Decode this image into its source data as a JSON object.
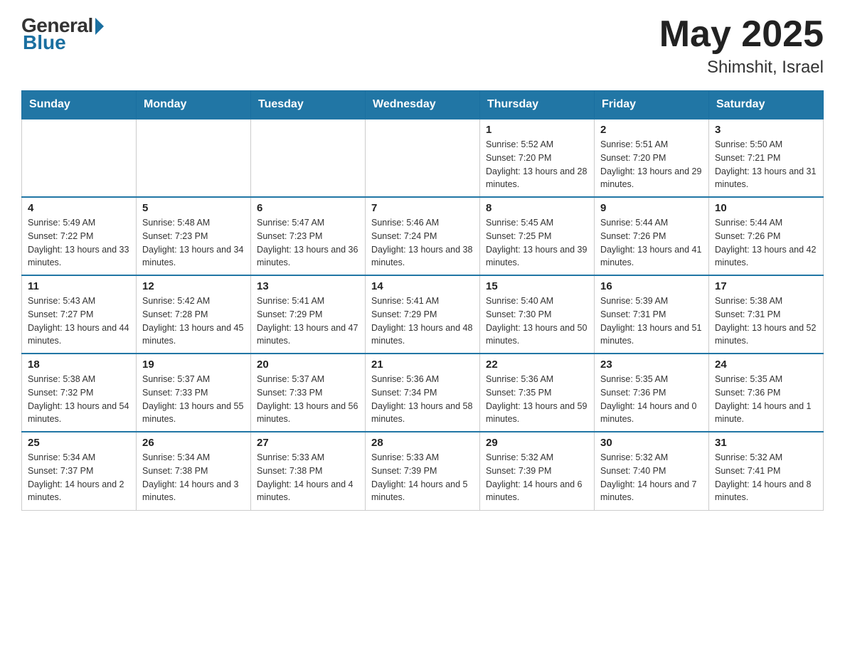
{
  "header": {
    "logo_general": "General",
    "logo_blue": "Blue",
    "month_year": "May 2025",
    "location": "Shimshit, Israel"
  },
  "days_of_week": [
    "Sunday",
    "Monday",
    "Tuesday",
    "Wednesday",
    "Thursday",
    "Friday",
    "Saturday"
  ],
  "weeks": [
    [
      {
        "day": "",
        "info": ""
      },
      {
        "day": "",
        "info": ""
      },
      {
        "day": "",
        "info": ""
      },
      {
        "day": "",
        "info": ""
      },
      {
        "day": "1",
        "info": "Sunrise: 5:52 AM\nSunset: 7:20 PM\nDaylight: 13 hours and 28 minutes."
      },
      {
        "day": "2",
        "info": "Sunrise: 5:51 AM\nSunset: 7:20 PM\nDaylight: 13 hours and 29 minutes."
      },
      {
        "day": "3",
        "info": "Sunrise: 5:50 AM\nSunset: 7:21 PM\nDaylight: 13 hours and 31 minutes."
      }
    ],
    [
      {
        "day": "4",
        "info": "Sunrise: 5:49 AM\nSunset: 7:22 PM\nDaylight: 13 hours and 33 minutes."
      },
      {
        "day": "5",
        "info": "Sunrise: 5:48 AM\nSunset: 7:23 PM\nDaylight: 13 hours and 34 minutes."
      },
      {
        "day": "6",
        "info": "Sunrise: 5:47 AM\nSunset: 7:23 PM\nDaylight: 13 hours and 36 minutes."
      },
      {
        "day": "7",
        "info": "Sunrise: 5:46 AM\nSunset: 7:24 PM\nDaylight: 13 hours and 38 minutes."
      },
      {
        "day": "8",
        "info": "Sunrise: 5:45 AM\nSunset: 7:25 PM\nDaylight: 13 hours and 39 minutes."
      },
      {
        "day": "9",
        "info": "Sunrise: 5:44 AM\nSunset: 7:26 PM\nDaylight: 13 hours and 41 minutes."
      },
      {
        "day": "10",
        "info": "Sunrise: 5:44 AM\nSunset: 7:26 PM\nDaylight: 13 hours and 42 minutes."
      }
    ],
    [
      {
        "day": "11",
        "info": "Sunrise: 5:43 AM\nSunset: 7:27 PM\nDaylight: 13 hours and 44 minutes."
      },
      {
        "day": "12",
        "info": "Sunrise: 5:42 AM\nSunset: 7:28 PM\nDaylight: 13 hours and 45 minutes."
      },
      {
        "day": "13",
        "info": "Sunrise: 5:41 AM\nSunset: 7:29 PM\nDaylight: 13 hours and 47 minutes."
      },
      {
        "day": "14",
        "info": "Sunrise: 5:41 AM\nSunset: 7:29 PM\nDaylight: 13 hours and 48 minutes."
      },
      {
        "day": "15",
        "info": "Sunrise: 5:40 AM\nSunset: 7:30 PM\nDaylight: 13 hours and 50 minutes."
      },
      {
        "day": "16",
        "info": "Sunrise: 5:39 AM\nSunset: 7:31 PM\nDaylight: 13 hours and 51 minutes."
      },
      {
        "day": "17",
        "info": "Sunrise: 5:38 AM\nSunset: 7:31 PM\nDaylight: 13 hours and 52 minutes."
      }
    ],
    [
      {
        "day": "18",
        "info": "Sunrise: 5:38 AM\nSunset: 7:32 PM\nDaylight: 13 hours and 54 minutes."
      },
      {
        "day": "19",
        "info": "Sunrise: 5:37 AM\nSunset: 7:33 PM\nDaylight: 13 hours and 55 minutes."
      },
      {
        "day": "20",
        "info": "Sunrise: 5:37 AM\nSunset: 7:33 PM\nDaylight: 13 hours and 56 minutes."
      },
      {
        "day": "21",
        "info": "Sunrise: 5:36 AM\nSunset: 7:34 PM\nDaylight: 13 hours and 58 minutes."
      },
      {
        "day": "22",
        "info": "Sunrise: 5:36 AM\nSunset: 7:35 PM\nDaylight: 13 hours and 59 minutes."
      },
      {
        "day": "23",
        "info": "Sunrise: 5:35 AM\nSunset: 7:36 PM\nDaylight: 14 hours and 0 minutes."
      },
      {
        "day": "24",
        "info": "Sunrise: 5:35 AM\nSunset: 7:36 PM\nDaylight: 14 hours and 1 minute."
      }
    ],
    [
      {
        "day": "25",
        "info": "Sunrise: 5:34 AM\nSunset: 7:37 PM\nDaylight: 14 hours and 2 minutes."
      },
      {
        "day": "26",
        "info": "Sunrise: 5:34 AM\nSunset: 7:38 PM\nDaylight: 14 hours and 3 minutes."
      },
      {
        "day": "27",
        "info": "Sunrise: 5:33 AM\nSunset: 7:38 PM\nDaylight: 14 hours and 4 minutes."
      },
      {
        "day": "28",
        "info": "Sunrise: 5:33 AM\nSunset: 7:39 PM\nDaylight: 14 hours and 5 minutes."
      },
      {
        "day": "29",
        "info": "Sunrise: 5:32 AM\nSunset: 7:39 PM\nDaylight: 14 hours and 6 minutes."
      },
      {
        "day": "30",
        "info": "Sunrise: 5:32 AM\nSunset: 7:40 PM\nDaylight: 14 hours and 7 minutes."
      },
      {
        "day": "31",
        "info": "Sunrise: 5:32 AM\nSunset: 7:41 PM\nDaylight: 14 hours and 8 minutes."
      }
    ]
  ]
}
